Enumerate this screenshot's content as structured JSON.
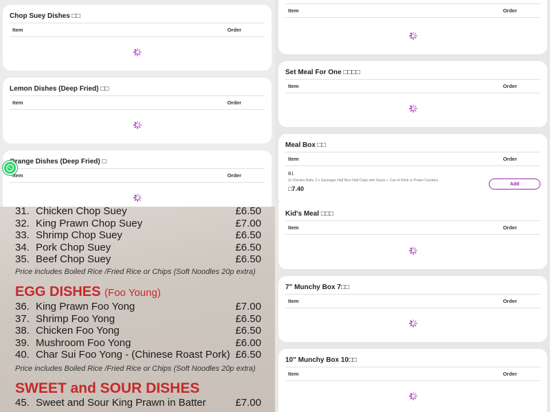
{
  "columns": {
    "item": "Item",
    "order": "Order"
  },
  "left_cards": [
    {
      "title": "Chop Suey Dishes □□"
    },
    {
      "title": "Lemon Dishes (Deep Fried) □□"
    },
    {
      "title": "Orange Dishes (Deep Fried) □"
    }
  ],
  "right_cards": [
    {
      "title": ""
    },
    {
      "title": "Set Meal For One □□□□"
    },
    {
      "title": "Meal Box □□"
    },
    {
      "title": "Kid's Meal □□□"
    },
    {
      "title": "7\" Munchy Box 7□□"
    },
    {
      "title": "10\" Munchy Box 10□□"
    }
  ],
  "meal_box_item": {
    "code": "B1",
    "description": "2x Chicken Balls, 2 x Sausages Half Rice Half Chips with Sauce + Can of Drink or Prawn Crackers",
    "price": "□7.40",
    "add_label": "Add"
  },
  "menu_photo": {
    "chop_suey": [
      {
        "num": "31.",
        "name": "Chicken Chop Suey",
        "price": "£6.50"
      },
      {
        "num": "32.",
        "name": "King Prawn Chop Suey",
        "price": "£7.00"
      },
      {
        "num": "33.",
        "name": "Shrimp Chop Suey",
        "price": "£6.50"
      },
      {
        "num": "34.",
        "name": "Pork Chop Suey",
        "price": "£6.50"
      },
      {
        "num": "35.",
        "name": "Beef Chop Suey",
        "price": "£6.50"
      }
    ],
    "note1": "Price includes Boiled Rice /Fried Rice or Chips (Soft Noodles 20p extra)",
    "egg_header": "EGG DISHES",
    "egg_sub": "(Foo Young)",
    "egg_dishes": [
      {
        "num": "36.",
        "name": "King Prawn Foo Yong",
        "price": "£7.00"
      },
      {
        "num": "37.",
        "name": "Shrimp Foo Yong",
        "price": "£6.50"
      },
      {
        "num": "38.",
        "name": "Chicken Foo Yong",
        "price": "£6.50"
      },
      {
        "num": "39.",
        "name": "Mushroom Foo Yong",
        "price": "£6.00"
      },
      {
        "num": "40.",
        "name": "Char Sui Foo Yong - (Chinese Roast Pork)",
        "price": "£6.50"
      }
    ],
    "note2": "Price includes Boiled Rice /Fried Rice or Chips (Soft Noodles 20p extra)",
    "sweet_header": "SWEET and SOUR DISHES",
    "sweet_dishes": [
      {
        "num": "45.",
        "name": "Sweet and Sour King Prawn in Batter",
        "price": "£7.00"
      }
    ]
  },
  "colors": {
    "accent": "#9c27b0",
    "whatsapp": "#25d366",
    "menu_red": "#c62828"
  },
  "icons": {
    "loading": "loading-spinner-icon",
    "chat": "whatsapp-icon"
  }
}
